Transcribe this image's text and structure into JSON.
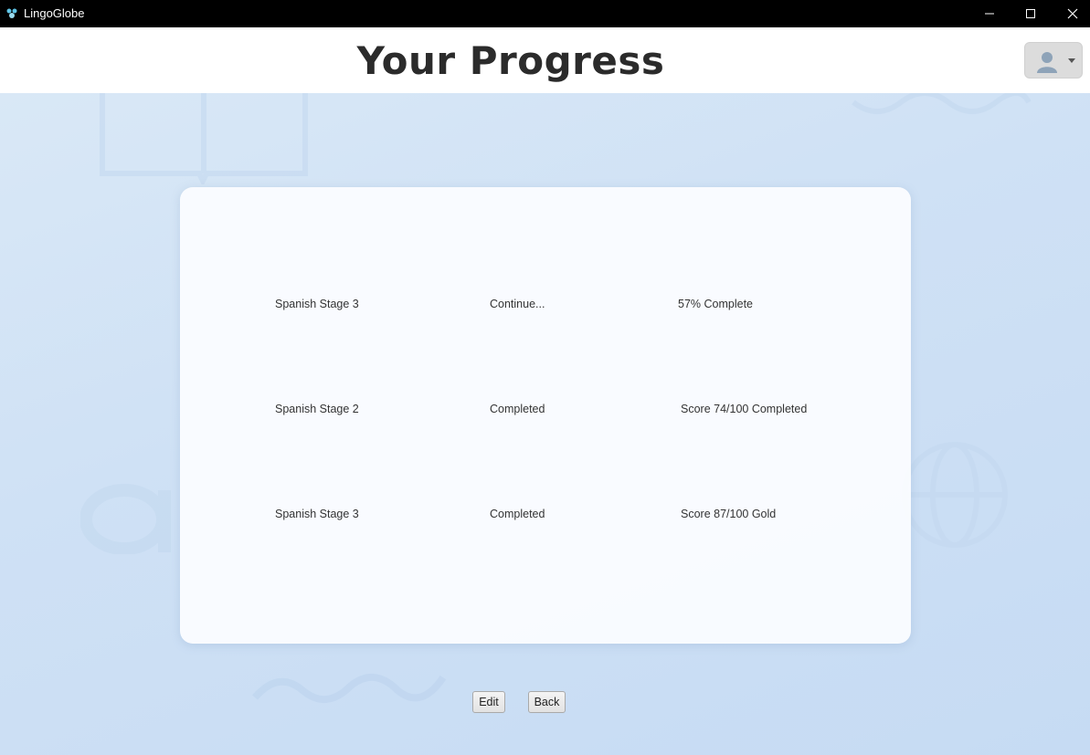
{
  "window": {
    "title": "LingoGlobe"
  },
  "header": {
    "title": "Your Progress"
  },
  "progress": {
    "rows": [
      {
        "name": "Spanish Stage 3",
        "status": "Continue...",
        "result": "57% Complete"
      },
      {
        "name": "Spanish Stage 2",
        "status": "Completed",
        "result": "Score 74/100 Completed"
      },
      {
        "name": "Spanish Stage 3",
        "status": "Completed",
        "result": "Score 87/100 Gold"
      }
    ]
  },
  "actions": {
    "edit_label": "Edit",
    "back_label": "Back"
  },
  "icons": {
    "app": "lingoglobe-logo-icon",
    "user": "user-avatar-icon",
    "dropdown": "chevron-down-icon"
  },
  "colors": {
    "titlebar": "#000000",
    "header_bg": "#ffffff",
    "page_bg": "#cfe0f4",
    "card_bg": "#fcfdff",
    "title_text": "#2b2b2b"
  }
}
